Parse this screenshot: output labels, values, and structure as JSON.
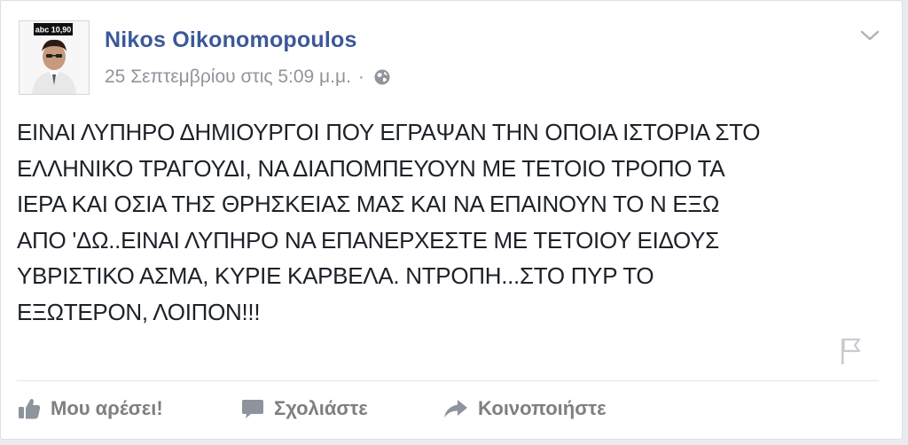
{
  "post": {
    "author_name": "Nikos Oikonomopoulos",
    "timestamp": "25 Σεπτεμβρίου στις 5:09 μ.μ.",
    "separator": "·",
    "audience_icon": "globe-icon",
    "menu_icon": "chevron-down-icon",
    "avatar": {
      "badge_text": "abc 10,90",
      "icon": "profile-photo"
    },
    "body_lines": [
      "ΕΙΝΑΙ ΛΥΠΗΡΟ ΔΗΜΙΟΥΡΓΟΙ ΠΟΥ ΕΓΡΑΨΑΝ ΤΗΝ ΟΠΟΙΑ ΙΣΤΟΡΙΑ ΣΤΟ",
      "ΕΛΛΗΝΙΚΟ ΤΡΑΓΟΥΔΙ, ΝΑ ΔΙΑΠΟΜΠΕΥΟΥΝ ΜΕ ΤΕΤΟΙΟ ΤΡΟΠΟ ΤΑ",
      "ΙΕΡΑ ΚΑΙ ΟΣΙΑ ΤΗΣ ΘΡΗΣΚΕΙΑΣ ΜΑΣ ΚΑΙ ΝΑ ΕΠΑΙΝΟΥΝ ΤΟ Ν ΕΞΩ",
      "ΑΠΟ 'ΔΩ..ΕΙΝΑΙ ΛΥΠΗΡΟ ΝΑ ΕΠΑΝΕΡΧΕΣΤΕ ΜΕ ΤΕΤΟΙΟΥ ΕΙΔΟΥΣ",
      "ΥΒΡΙΣΤΙΚΟ ΑΣΜΑ, ΚΥΡΙΕ ΚΑΡΒΕΛΑ. ΝΤΡΟΠΗ...ΣΤΟ ΠΥΡ ΤΟ",
      "ΕΞΩΤΕΡΟΝ, ΛΟΙΠΟΝ!!!"
    ],
    "flag_icon": "flag-icon"
  },
  "actions": {
    "like_label": "Μου αρέσει!",
    "comment_label": "Σχολιάστε",
    "share_label": "Κοινοποιήστε",
    "like_icon": "thumbs-up-icon",
    "comment_icon": "speech-bubble-icon",
    "share_icon": "share-arrow-icon"
  },
  "colors": {
    "author": "#3b5998",
    "meta": "#90949c",
    "body_text": "#1d2129",
    "action": "#7f7f7f"
  }
}
